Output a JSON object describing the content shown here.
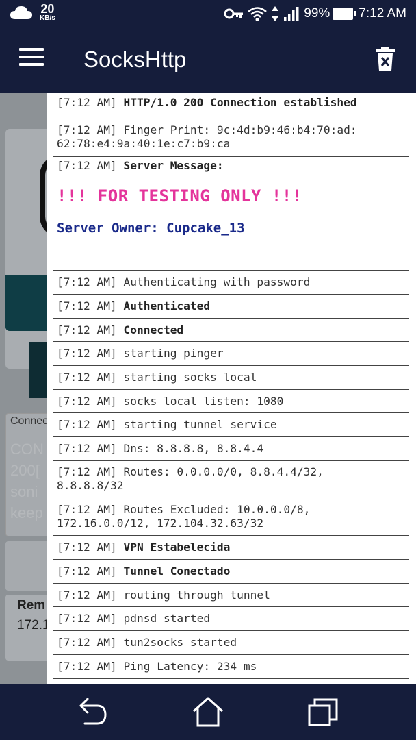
{
  "status_bar": {
    "network_speed": "20",
    "network_unit": "KB/s",
    "battery": "99%",
    "time": "7:12 AM",
    "icons": [
      "cloud-icon",
      "vpn-key-icon",
      "wifi-icon",
      "data-arrows-icon",
      "signal-icon",
      "battery-icon"
    ]
  },
  "app_bar": {
    "title": "SocksHttp",
    "menu_icon": "hamburger-menu-icon",
    "trash_icon": "delete-icon"
  },
  "background": {
    "connection_label": "Connec",
    "faded_lines": [
      "CON",
      "200[",
      "soni",
      "keep"
    ],
    "remote_label": "Rem",
    "remote_ip": "172.1"
  },
  "log": {
    "entries": [
      {
        "ts": "[7:12 AM]",
        "msg": "HTTP/1.0 200 Connection established",
        "bold": true
      },
      {
        "ts": "[7:12 AM]",
        "msg": "Finger Print: 9c:4d:b9:46:b4:70:ad:\n62:78:e4:9a:40:1e:c7:b9:ca",
        "bold": false
      },
      {
        "ts": "[7:12 AM]",
        "msg": "Server Message:",
        "bold": true
      },
      {
        "ts": "[7:12 AM]",
        "msg": "Authenticating with password",
        "bold": false
      },
      {
        "ts": "[7:12 AM]",
        "msg": "Authenticated",
        "bold": true
      },
      {
        "ts": "[7:12 AM]",
        "msg": "Connected",
        "bold": true
      },
      {
        "ts": "[7:12 AM]",
        "msg": "starting pinger",
        "bold": false
      },
      {
        "ts": "[7:12 AM]",
        "msg": "starting socks local",
        "bold": false
      },
      {
        "ts": "[7:12 AM]",
        "msg": "socks local listen: 1080",
        "bold": false
      },
      {
        "ts": "[7:12 AM]",
        "msg": "starting tunnel service",
        "bold": false
      },
      {
        "ts": "[7:12 AM]",
        "msg": "Dns: 8.8.8.8, 8.8.4.4",
        "bold": false
      },
      {
        "ts": "[7:12 AM]",
        "msg": "Routes: 0.0.0.0/0, 8.8.4.4/32,\n8.8.8.8/32",
        "bold": false
      },
      {
        "ts": "[7:12 AM]",
        "msg": "Routes Excluded: 10.0.0.0/8,\n172.16.0.0/12, 172.104.32.63/32",
        "bold": false
      },
      {
        "ts": "[7:12 AM]",
        "msg": "VPN Estabelecida",
        "bold": true
      },
      {
        "ts": "[7:12 AM]",
        "msg": "Tunnel Conectado",
        "bold": true
      },
      {
        "ts": "[7:12 AM]",
        "msg": "routing through tunnel",
        "bold": false
      },
      {
        "ts": "[7:12 AM]",
        "msg": "pdnsd started",
        "bold": false
      },
      {
        "ts": "[7:12 AM]",
        "msg": "tun2socks started",
        "bold": false
      },
      {
        "ts": "[7:12 AM]",
        "msg": "Ping Latency: 234 ms",
        "bold": false
      }
    ],
    "server_message": {
      "warning": "!!! FOR TESTING ONLY !!!",
      "owner": "Server Owner: Cupcake_13",
      "warning_color": "#e4349b",
      "owner_color": "#1a2a8a"
    }
  },
  "nav_bar": {
    "icons": [
      "back-icon",
      "home-icon",
      "recents-icon"
    ]
  },
  "colors": {
    "bar_background": "#151d3b",
    "dim_overlay": "#8d9296"
  }
}
